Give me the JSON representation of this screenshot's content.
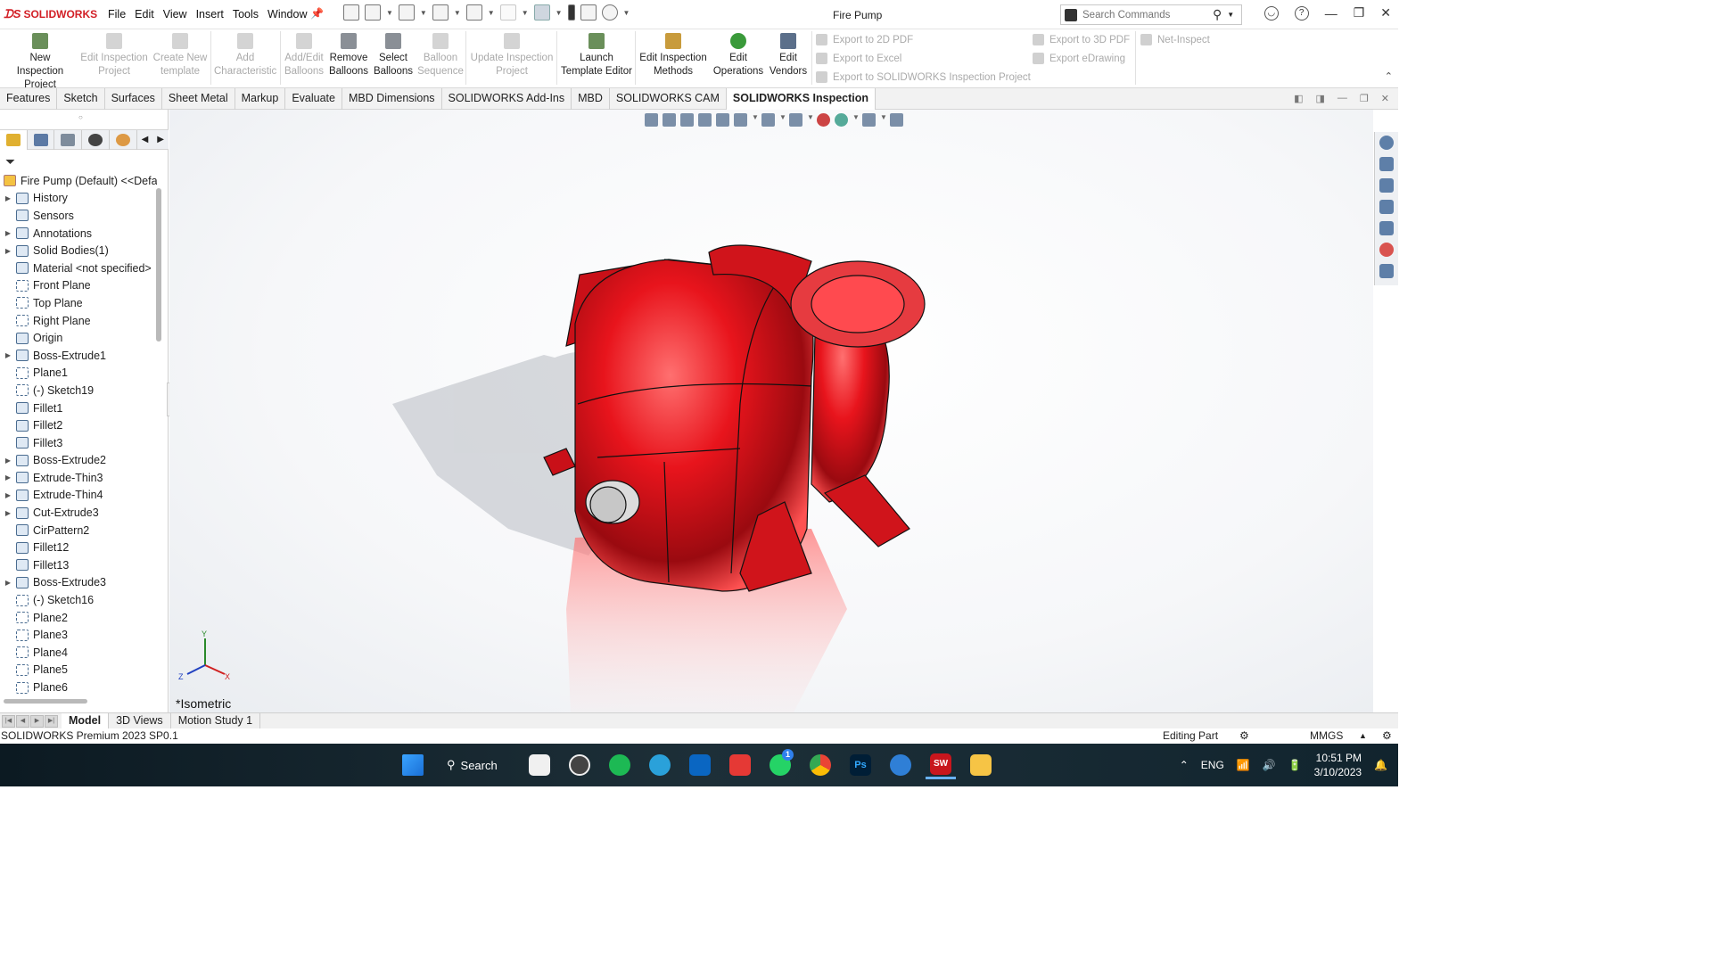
{
  "app": {
    "logo_text": "SOLIDWORKS",
    "document_title": "Fire Pump"
  },
  "menu": [
    "File",
    "Edit",
    "View",
    "Insert",
    "Tools",
    "Window"
  ],
  "search": {
    "placeholder": "Search Commands"
  },
  "ribbon": {
    "buttons": [
      {
        "label1": "New Inspection",
        "label2": "Project",
        "enabled": true
      },
      {
        "label1": "Edit Inspection",
        "label2": "Project",
        "enabled": false
      },
      {
        "label1": "Create New",
        "label2": "template",
        "enabled": false
      },
      {
        "label1": "Add",
        "label2": "Characteristic",
        "enabled": false
      },
      {
        "label1": "Add/Edit",
        "label2": "Balloons",
        "enabled": false
      },
      {
        "label1": "Remove",
        "label2": "Balloons",
        "enabled": true
      },
      {
        "label1": "Select",
        "label2": "Balloons",
        "enabled": true
      },
      {
        "label1": "Balloon",
        "label2": "Sequence",
        "enabled": false
      },
      {
        "label1": "Update Inspection",
        "label2": "Project",
        "enabled": false
      },
      {
        "label1": "Launch",
        "label2": "Template Editor",
        "enabled": true
      },
      {
        "label1": "Edit Inspection",
        "label2": "Methods",
        "enabled": true
      },
      {
        "label1": "Edit",
        "label2": "Operations",
        "enabled": true
      },
      {
        "label1": "Edit",
        "label2": "Vendors",
        "enabled": true
      }
    ],
    "exports": [
      "Export to 2D PDF",
      "Export to Excel",
      "Export to SOLIDWORKS Inspection Project",
      "Export to 3D PDF",
      "Export eDrawing",
      "Net-Inspect"
    ]
  },
  "tabs": [
    "Features",
    "Sketch",
    "Surfaces",
    "Sheet Metal",
    "Markup",
    "Evaluate",
    "MBD Dimensions",
    "SOLIDWORKS Add-Ins",
    "MBD",
    "SOLIDWORKS CAM",
    "SOLIDWORKS Inspection"
  ],
  "active_tab": "SOLIDWORKS Inspection",
  "tree": {
    "root": "Fire Pump (Default) <<Defa",
    "items": [
      {
        "label": "History",
        "expandable": true
      },
      {
        "label": "Sensors",
        "expandable": false
      },
      {
        "label": "Annotations",
        "expandable": true
      },
      {
        "label": "Solid Bodies(1)",
        "expandable": true
      },
      {
        "label": "Material <not specified>",
        "expandable": false
      },
      {
        "label": "Front Plane",
        "expandable": false
      },
      {
        "label": "Top Plane",
        "expandable": false
      },
      {
        "label": "Right Plane",
        "expandable": false
      },
      {
        "label": "Origin",
        "expandable": false
      },
      {
        "label": "Boss-Extrude1",
        "expandable": true
      },
      {
        "label": "Plane1",
        "expandable": false
      },
      {
        "label": "(-) Sketch19",
        "expandable": false
      },
      {
        "label": "Fillet1",
        "expandable": false
      },
      {
        "label": "Fillet2",
        "expandable": false
      },
      {
        "label": "Fillet3",
        "expandable": false
      },
      {
        "label": "Boss-Extrude2",
        "expandable": true
      },
      {
        "label": "Extrude-Thin3",
        "expandable": true
      },
      {
        "label": "Extrude-Thin4",
        "expandable": true
      },
      {
        "label": "Cut-Extrude3",
        "expandable": true
      },
      {
        "label": "CirPattern2",
        "expandable": false
      },
      {
        "label": "Fillet12",
        "expandable": false
      },
      {
        "label": "Fillet13",
        "expandable": false
      },
      {
        "label": "Boss-Extrude3",
        "expandable": true
      },
      {
        "label": "(-) Sketch16",
        "expandable": false
      },
      {
        "label": "Plane2",
        "expandable": false
      },
      {
        "label": "Plane3",
        "expandable": false
      },
      {
        "label": "Plane4",
        "expandable": false
      },
      {
        "label": "Plane5",
        "expandable": false
      },
      {
        "label": "Plane6",
        "expandable": false
      }
    ]
  },
  "viewport": {
    "view_name": "*Isometric",
    "model_color": "#e8141c",
    "triad": {
      "x": "X",
      "y": "Y",
      "z": "Z"
    }
  },
  "bottom_tabs": [
    "Model",
    "3D Views",
    "Motion Study 1"
  ],
  "active_bottom_tab": "Model",
  "status": {
    "left": "SOLIDWORKS Premium 2023 SP0.1",
    "mode": "Editing Part",
    "units": "MMGS"
  },
  "taskbar": {
    "search_label": "Search",
    "lang": "ENG",
    "time": "10:51 PM",
    "date": "3/10/2023",
    "whatsapp_badge": "1"
  }
}
